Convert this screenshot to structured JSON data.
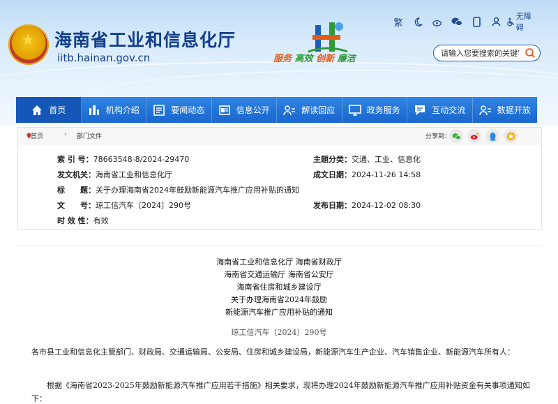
{
  "site": {
    "title": "海南省工业和信息化厅",
    "domain": "iitb.hainan.gov.cn",
    "slogan_1": "服务",
    "slogan_2": "高效",
    "slogan_3": "创新",
    "slogan_4": "廉洁"
  },
  "toolbar": {
    "traditional": "繁",
    "accessible": "无障碍"
  },
  "search": {
    "placeholder": "请输入您要搜索的关键字"
  },
  "nav": [
    {
      "label": "首页",
      "icon": "home-icon"
    },
    {
      "label": "机构介绍",
      "icon": "building-icon"
    },
    {
      "label": "要闻动态",
      "icon": "news-icon"
    },
    {
      "label": "信息公开",
      "icon": "document-icon"
    },
    {
      "label": "解读回应",
      "icon": "people-icon"
    },
    {
      "label": "政务服务",
      "icon": "monitor-icon"
    },
    {
      "label": "互动交流",
      "icon": "chat-icon"
    },
    {
      "label": "数据开放",
      "icon": "data-icon"
    }
  ],
  "breadcrumb": {
    "home": "首页",
    "sep": "›",
    "current": "部门文件",
    "share_label": "分享到："
  },
  "meta": {
    "index_key": "索 引 号：",
    "index_val": "78663548-8/2024-29470",
    "topic_key": "主题分类：",
    "topic_val": "交通、工业、信息化",
    "issuer_key": "发文机关：",
    "issuer_val": "海南省工业和信息化厅",
    "created_key": "成文日期：",
    "created_val": "2024-11-26 14:58",
    "title_key": "标　　题：",
    "title_val": "关于办理海南省2024年鼓励新能源汽车推广应用补贴的通知",
    "docno_key": "文　　号：",
    "docno_val": "琼工信汽车〔2024〕290号",
    "published_key": "发布日期：",
    "published_val": "2024-12-02 08:30",
    "validity_key": "时 效 性：",
    "validity_val": "有效"
  },
  "article": {
    "line1": "海南省工业和信息化厅  海南省财政厅",
    "line2": "海南省交通运输厅  海南省公安厅",
    "line3": "海南省住房和城乡建设厅",
    "line4": "关于办理海南省2024年鼓励",
    "line5": "新能源汽车推广应用补贴的通知",
    "doc_no": "琼工信汽车〔2024〕290号",
    "para1": "各市县工业和信息化主管部门、财政局、交通运输局、公安局、住房和城乡建设局，新能源汽车生产企业、汽车销售企业、新能源汽车所有人：",
    "para2": "　　根据《海南省2023-2025年鼓励新能源汽车推广应用若干措施》相关要求，现将办理2024年鼓励新能源汽车推广应用补贴资金有关事项通知如下："
  },
  "colors": {
    "nav_blue": "#1a66cf",
    "title_blue": "#123e8a",
    "slogan_orange": "#e35a17"
  }
}
